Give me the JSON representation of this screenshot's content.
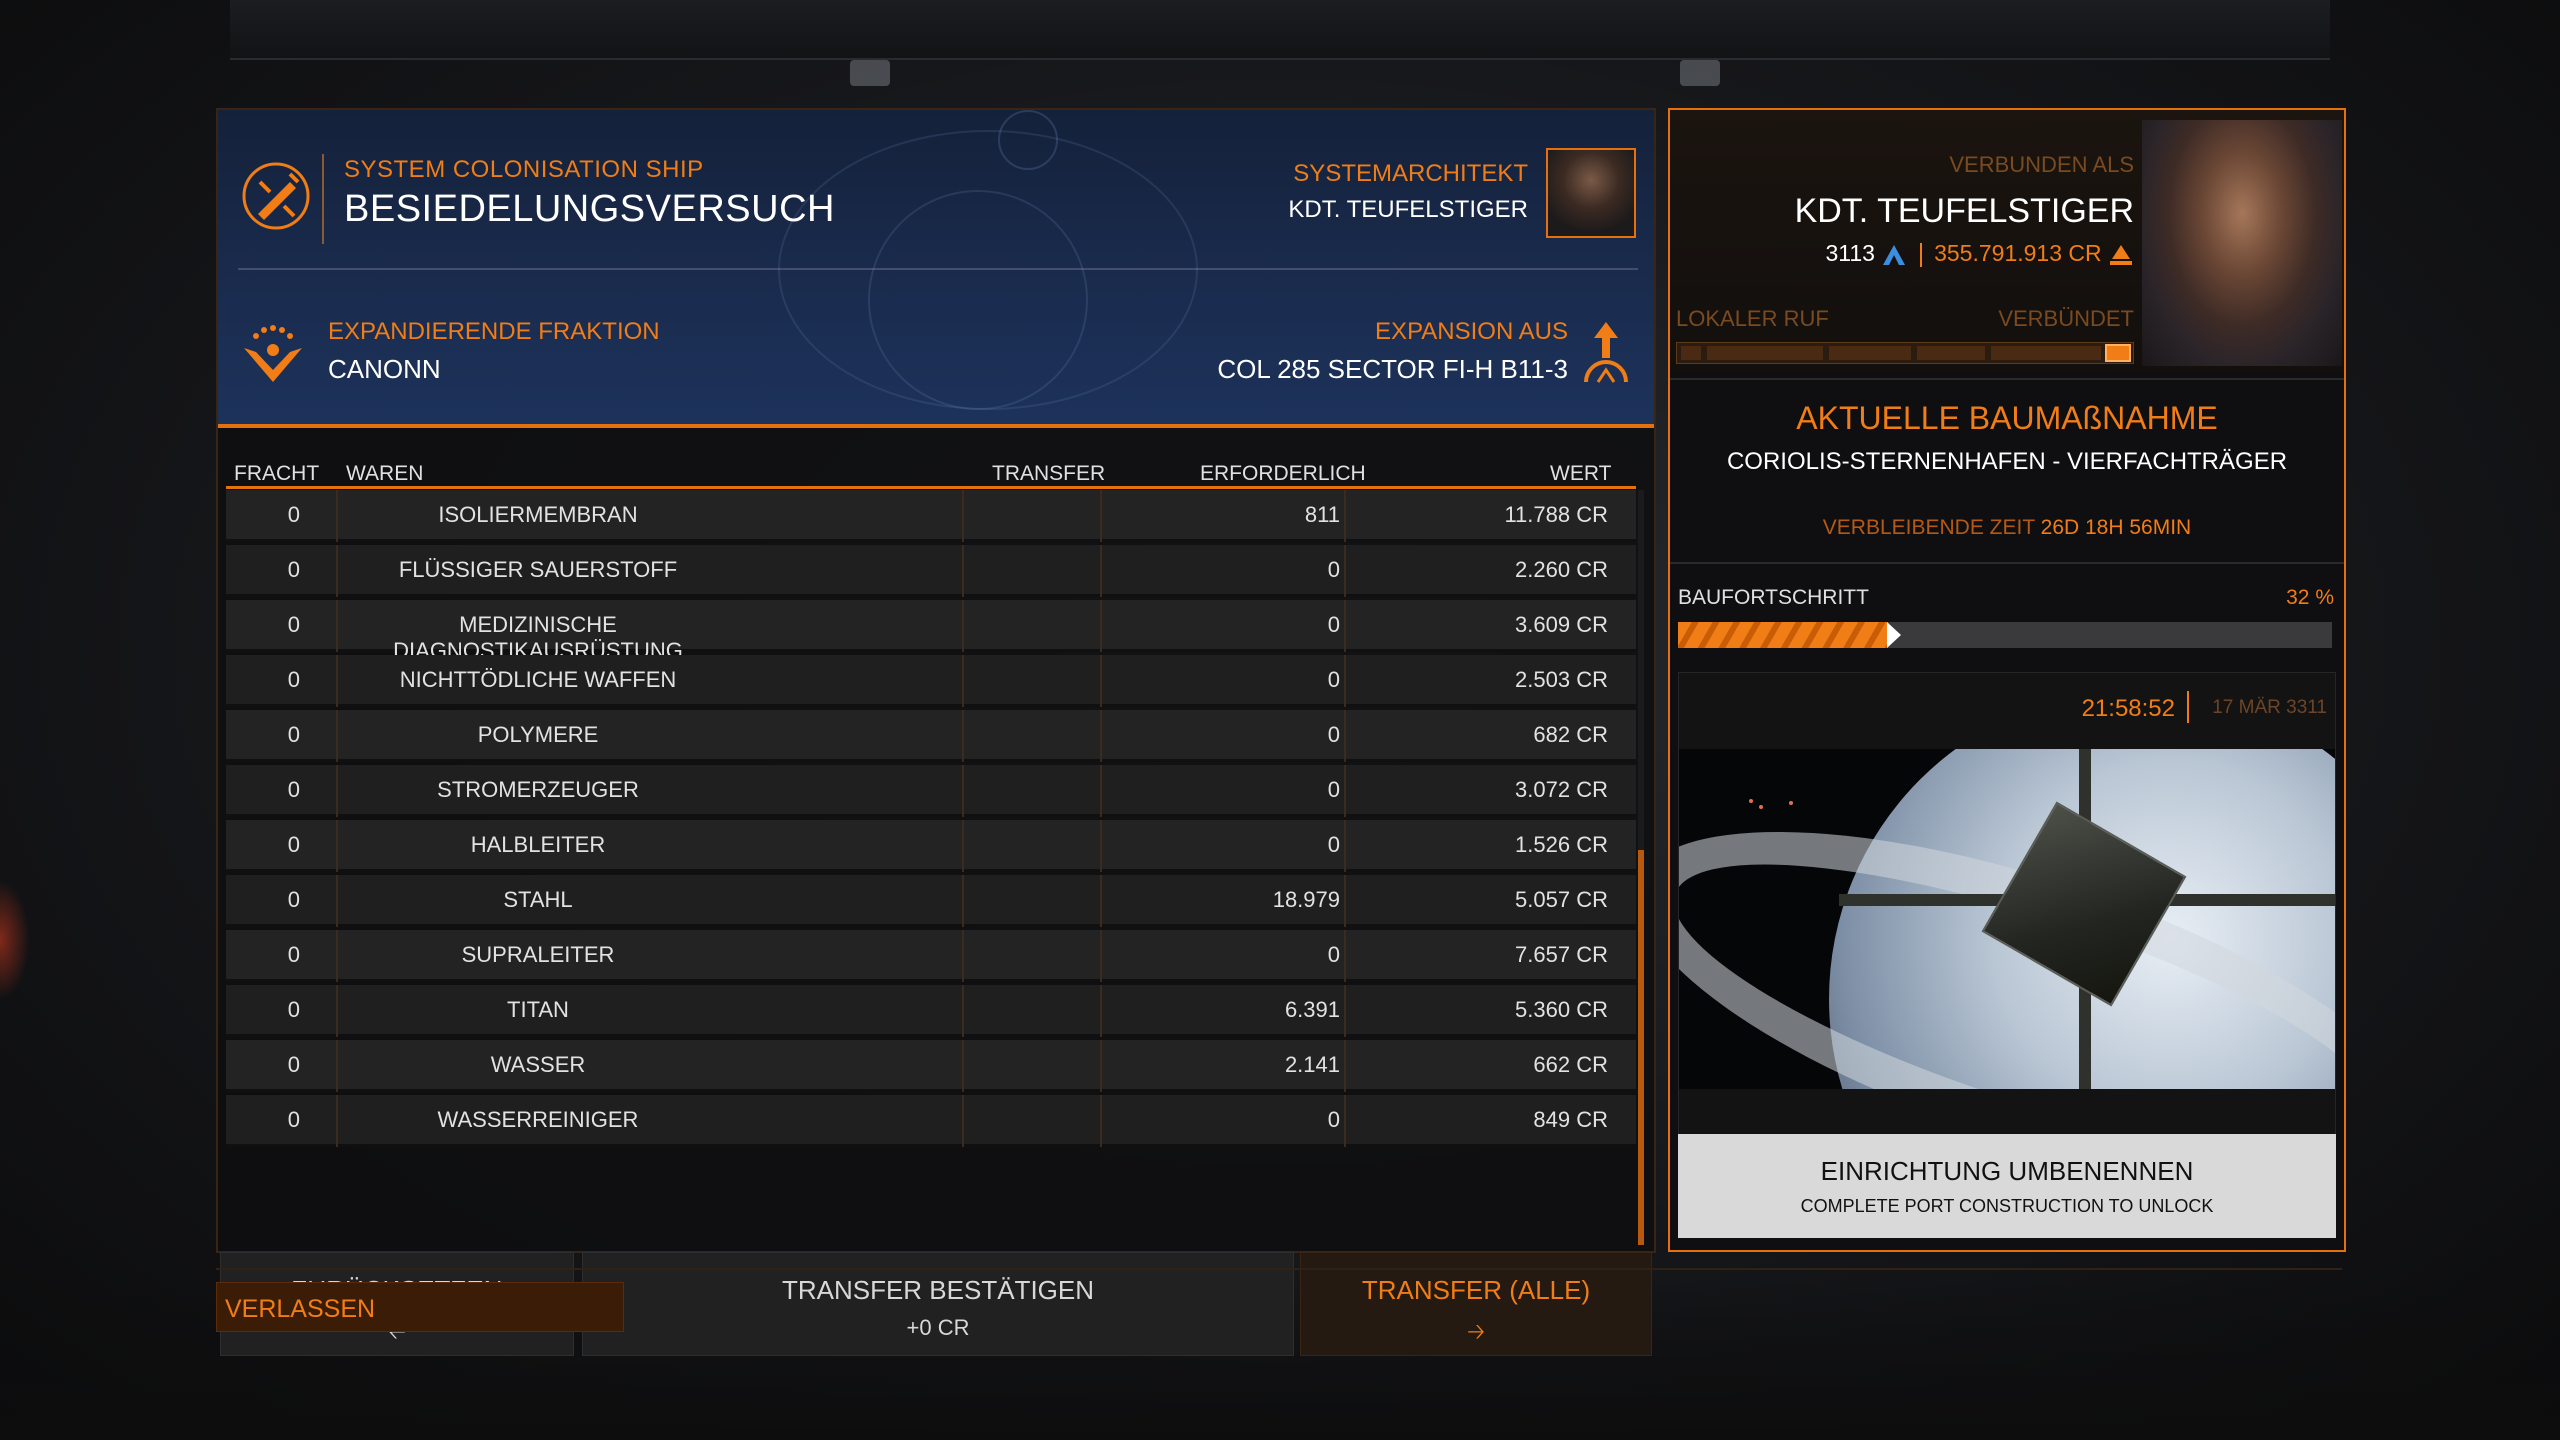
{
  "header": {
    "ship_subtitle": "SYSTEM COLONISATION SHIP",
    "ship_title": "BESIEDELUNGSVERSUCH",
    "architect_label": "SYSTEMARCHITEKT",
    "architect_name": "KDT. TEUFELSTIGER",
    "faction_label": "EXPANDIERENDE FRAKTION",
    "faction_name": "CANONN",
    "expansion_label": "EXPANSION AUS",
    "expansion_system": "COL 285 SECTOR FI-H B11-3"
  },
  "table": {
    "columns": [
      "FRACHT",
      "WAREN",
      "TRANSFER",
      "ERFORDERLICH",
      "WERT"
    ],
    "rows": [
      {
        "cargo": "0",
        "commodity": "ISOLIERMEMBRAN",
        "transfer": "",
        "required": "811",
        "value": "11.788 CR"
      },
      {
        "cargo": "0",
        "commodity": "FLÜSSIGER SAUERSTOFF",
        "transfer": "",
        "required": "0",
        "value": "2.260 CR"
      },
      {
        "cargo": "0",
        "commodity": "MEDIZINISCHE DIAGNOSTIKAUSRÜSTUNG",
        "transfer": "",
        "required": "0",
        "value": "3.609 CR"
      },
      {
        "cargo": "0",
        "commodity": "NICHTTÖDLICHE WAFFEN",
        "transfer": "",
        "required": "0",
        "value": "2.503 CR"
      },
      {
        "cargo": "0",
        "commodity": "POLYMERE",
        "transfer": "",
        "required": "0",
        "value": "682 CR"
      },
      {
        "cargo": "0",
        "commodity": "STROMERZEUGER",
        "transfer": "",
        "required": "0",
        "value": "3.072 CR"
      },
      {
        "cargo": "0",
        "commodity": "HALBLEITER",
        "transfer": "",
        "required": "0",
        "value": "1.526 CR"
      },
      {
        "cargo": "0",
        "commodity": "STAHL",
        "transfer": "",
        "required": "18.979",
        "value": "5.057 CR"
      },
      {
        "cargo": "0",
        "commodity": "SUPRALEITER",
        "transfer": "",
        "required": "0",
        "value": "7.657 CR"
      },
      {
        "cargo": "0",
        "commodity": "TITAN",
        "transfer": "",
        "required": "6.391",
        "value": "5.360 CR"
      },
      {
        "cargo": "0",
        "commodity": "WASSER",
        "transfer": "",
        "required": "2.141",
        "value": "662 CR"
      },
      {
        "cargo": "0",
        "commodity": "WASSERREINIGER",
        "transfer": "",
        "required": "0",
        "value": "849 CR"
      }
    ]
  },
  "buttons": {
    "reset_label": "ZURÜCKSETZEN",
    "reset_icon": "arrow-left",
    "confirm_label": "TRANSFER BESTÄTIGEN",
    "confirm_sub": "+0 CR",
    "transfer_all_label": "TRANSFER (ALLE)",
    "transfer_all_icon": "arrow-right",
    "leave_label": "VERLASSEN"
  },
  "commander": {
    "connected_as": "VERBUNDEN ALS",
    "name": "KDT. TEUFELSTIGER",
    "rank": "3113",
    "credits": "355.791.913 CR",
    "rep_label_left": "LOKALER RUF",
    "rep_label_right": "VERBÜNDET"
  },
  "construction": {
    "title": "AKTUELLE BAUMAßNAHME",
    "name": "CORIOLIS-STERNENHAFEN - VIERFACHTRÄGER",
    "remaining_label": "VERBLEIBENDE ZEIT",
    "remaining_value": "26D 18H 56MIN",
    "progress_label": "BAUFORTSCHRITT",
    "progress_pct_text": "32 %",
    "progress_fraction": 0.32,
    "clock": "21:58:52",
    "date": "17 MÄR 3311",
    "rename_label": "EINRICHTUNG UMBENENNEN",
    "rename_sub": "COMPLETE PORT CONSTRUCTION TO UNLOCK"
  },
  "colors": {
    "accent": "#f07d15",
    "panel_dark": "#212122",
    "header_blue": "#1a2c4f"
  }
}
